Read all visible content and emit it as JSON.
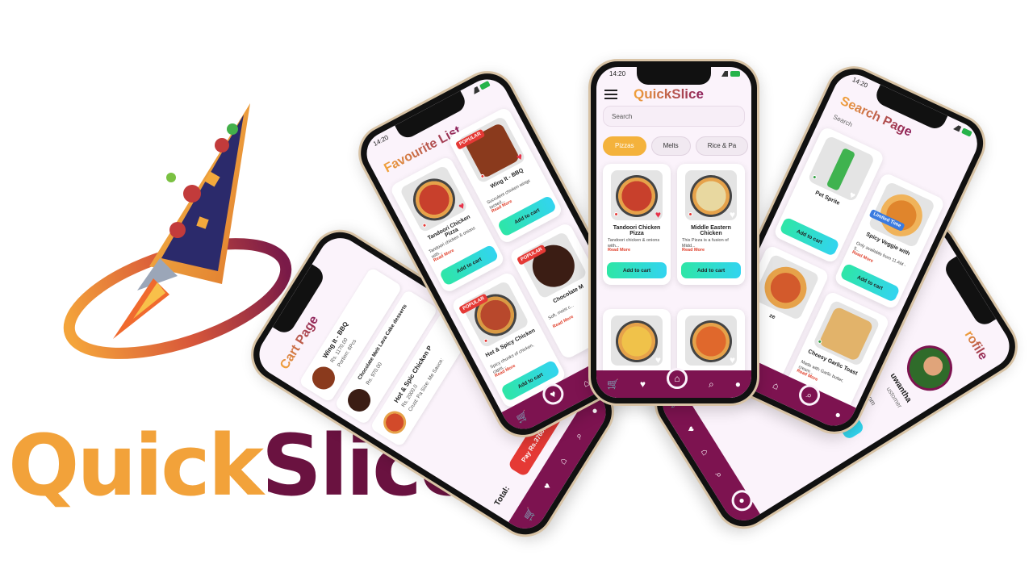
{
  "brand": {
    "wordmark_parts": [
      "Quick",
      "Slice"
    ],
    "colors": {
      "orange": "#f2a23a",
      "plum": "#6a1240",
      "accent": "#7d1350"
    }
  },
  "status": {
    "time": "14:20"
  },
  "home": {
    "title": "QuickSlice",
    "search_placeholder": "Search",
    "chips": [
      "Pizzas",
      "Melts",
      "Rice & Pa"
    ],
    "cards": [
      {
        "name": "Tandoori Chicken Pizza",
        "desc": "Tandoori chicken & onions with...",
        "more": "Read More",
        "cart": "Add to cart"
      },
      {
        "name": "Middle Eastern Chicken",
        "desc": "This Pizza is a fusion of Midd...",
        "more": "Read More",
        "cart": "Add to cart"
      }
    ]
  },
  "favourite": {
    "title": "Favourite List",
    "cards": [
      {
        "name": "Tandoori Chicken Pizza",
        "desc": "Tandoori chicken & onions with...",
        "more": "Read More",
        "cart": "Add to cart",
        "badge": ""
      },
      {
        "name": "Wing It - BBQ",
        "desc": "Succulent chicken wings tossed...",
        "more": "Read More",
        "cart": "Add to cart",
        "badge": "POPULAR"
      },
      {
        "name": "Hot & Spicy Chicken",
        "desc": "Spicy chunks of chicken, capsi...",
        "more": "Read More",
        "cart": "Add to cart",
        "badge": "POPULAR"
      },
      {
        "name": "Chocolate M",
        "desc": "Soft, moist c...",
        "more": "Read More",
        "cart": "",
        "badge": "POPULAR"
      }
    ]
  },
  "cart": {
    "title": "Cart Page",
    "items": [
      {
        "name": "Wing It - BBQ",
        "price": "Rs. 1170.00",
        "meta": "Portion: 6Pcs"
      },
      {
        "name": "Chocolate Melt Lava Cake desserts",
        "price": "Rs. 970.00",
        "meta": ""
      },
      {
        "name": "Hot & Spic Chicken P",
        "price": "Rs. 2000.0",
        "meta": "Crust: Pa  Size: Me  Sauce:"
      }
    ],
    "total_label": "Total:",
    "pay_label": "Pay Rs.3760.00 (USD"
  },
  "search": {
    "title": "Search Page",
    "placeholder": "Search",
    "cards": [
      {
        "name": "Pet Sprite",
        "cart": "Add to cart",
        "badge": ""
      },
      {
        "name": "Spicy Veggie with",
        "desc": "Only available from 11 AM - 5...",
        "more": "Read More",
        "cart": "Add to cart",
        "badge": "Limited Time"
      },
      {
        "name": "ze",
        "badge": ""
      },
      {
        "name": "Cheesy Garlic Toast",
        "desc": "Made with Garlic butter, cream...",
        "more": "Read More",
        "badge": ""
      }
    ]
  },
  "profile": {
    "title": "rofile",
    "name": "uwantha",
    "role": "ustomer",
    "extra": "om"
  }
}
